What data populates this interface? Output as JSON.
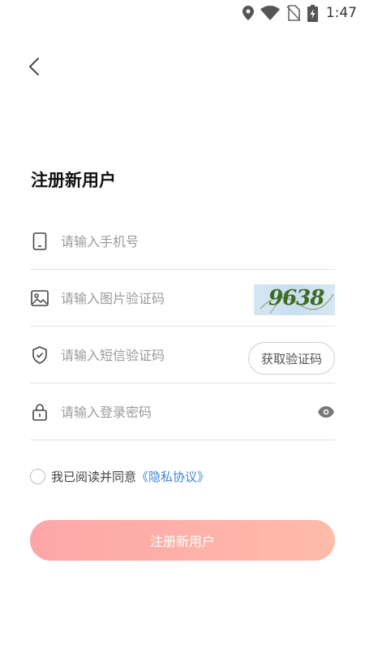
{
  "status_bar": {
    "time": "1:47",
    "icons": [
      "location-icon",
      "wifi-icon",
      "no-sim-icon",
      "battery-charging-icon"
    ]
  },
  "header": {
    "back_icon": "chevron-left-icon"
  },
  "page": {
    "title": "注册新用户"
  },
  "form": {
    "phone": {
      "placeholder": "请输入手机号",
      "value": "",
      "icon": "phone-icon"
    },
    "captcha": {
      "placeholder": "请输入图片验证码",
      "value": "",
      "icon": "image-icon",
      "image_text": "9638"
    },
    "sms_code": {
      "placeholder": "请输入短信验证码",
      "value": "",
      "icon": "shield-check-icon",
      "button_label": "获取验证码"
    },
    "password": {
      "placeholder": "请输入登录密码",
      "value": "",
      "icon": "lock-icon",
      "toggle_icon": "eye-icon"
    }
  },
  "agreement": {
    "text": "我已阅读并同意",
    "link": "《隐私协议》",
    "checked": false
  },
  "submit": {
    "label": "注册新用户"
  },
  "colors": {
    "accent_link": "#3f86d8",
    "button_gradient_start": "#fda6a9",
    "button_gradient_end": "#febba8",
    "captcha_text": "#3e6b1e"
  }
}
